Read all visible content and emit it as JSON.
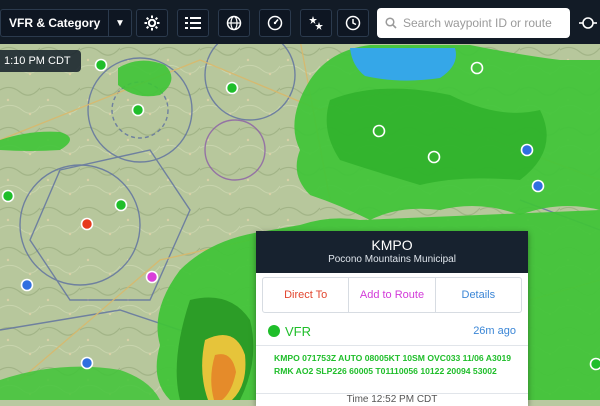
{
  "toolbar": {
    "layer_select_label": "VFR & Category",
    "search_placeholder": "Search waypoint ID or route",
    "buttons": [
      "settings-icon",
      "layers-list-icon",
      "globe-icon",
      "gauge-icon",
      "airspace-icon",
      "clock-icon",
      "route-icon"
    ]
  },
  "time_badge": "1:10 PM CDT",
  "popup": {
    "airport_id": "KMPO",
    "airport_name": "Pocono Mountains Municipal",
    "actions": [
      "Direct To",
      "Add to Route",
      "Details"
    ],
    "action_colors": [
      "#e2462f",
      "#d23ad9",
      "#3b86d6"
    ],
    "flight_category": "VFR",
    "age": "26m ago",
    "metar": "KMPO 071753Z AUTO 08005KT 10SM OVC033 11/06 A3019 RMK AO2 SLP226 60005 T01110056 10122 20094 53002",
    "timeline_partial": "Time 12:52 PM CDT"
  },
  "colors": {
    "vfr_green": "#1fbe2a",
    "toolbar_bg": "#121b26",
    "mvfr_blue": "#2f6fe0",
    "ifr_red": "#e6391c",
    "lifr_magenta": "#d93fd9"
  },
  "map_markers": [
    {
      "category": "VFR",
      "color": "#1fbe2a"
    },
    {
      "category": "MVFR",
      "color": "#2f6fe0"
    },
    {
      "category": "IFR",
      "color": "#e6391c"
    },
    {
      "category": "LIFR",
      "color": "#d93fd9"
    },
    {
      "category": "no-report",
      "color": "#ffffff"
    }
  ]
}
